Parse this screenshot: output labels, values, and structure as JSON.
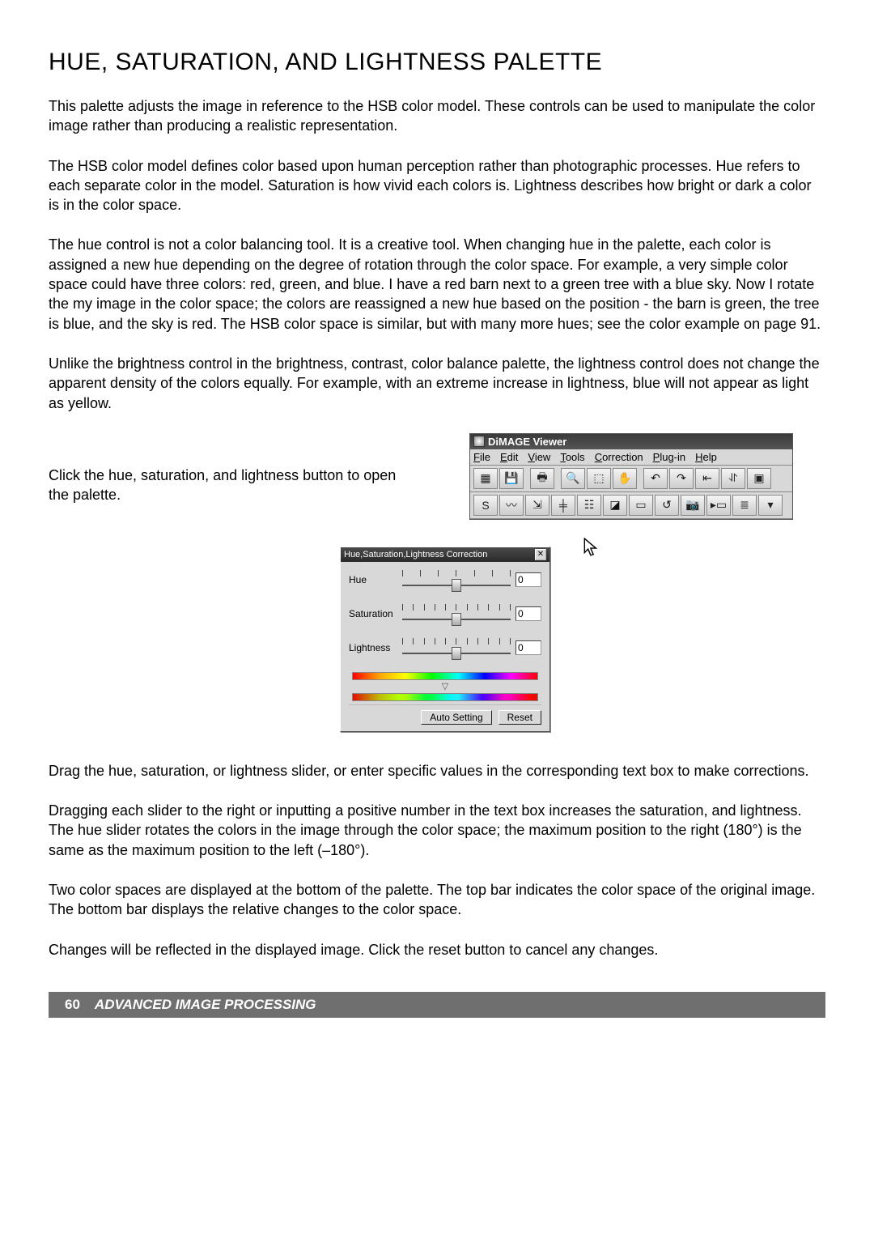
{
  "page": {
    "title": "HUE, SATURATION, AND LIGHTNESS PALETTE",
    "paragraphs": [
      "This palette adjusts the image in reference to the HSB color model. These controls can be used to manipulate the color image rather than producing a realistic representation.",
      "The HSB color model defines color based upon human perception rather than photographic processes. Hue refers to each separate color in the model. Saturation is how vivid each colors is. Lightness describes how bright or dark a color is in the color space.",
      "The hue control is not a color balancing tool. It is a creative tool. When changing hue in the palette, each color is assigned a new hue depending on the degree of rotation through the color space. For example, a very simple color space could have three colors: red, green, and blue. I have a red barn next to a green tree with a blue sky. Now I rotate the my image in the color space; the colors are reassigned a new hue based on the position - the barn is green, the tree is blue, and the sky is red. The HSB color space is similar, but with many more hues; see the color example on page 91.",
      "Unlike the brightness control in the brightness, contrast, color balance palette, the lightness control does not change the apparent density of the colors equally. For example, with an extreme increase in lightness, blue will not appear as light as yellow."
    ],
    "side_paragraph": "Click the hue, saturation, and lightness button to open the palette.",
    "lower_paragraphs": [
      "Drag the hue, saturation, or lightness slider, or enter specific values in the corresponding text box to make corrections.",
      "Dragging each slider to the right or inputting a positive number in the text box increases the saturation, and lightness. The hue slider rotates the colors in the image through the color space; the maximum position to the right (180°) is the same as the maximum position to the left (–180°).",
      "Two color spaces are displayed at the bottom of the palette. The top bar indicates the color space of the original image. The bottom bar displays the relative changes to the color space.",
      "Changes will be reflected in the displayed image. Click the reset button to cancel any changes."
    ]
  },
  "viewer": {
    "app_title": "DiMAGE Viewer",
    "menus": [
      "File",
      "Edit",
      "View",
      "Tools",
      "Correction",
      "Plug-in",
      "Help"
    ],
    "toolbar1_icons": [
      "thumbnails-icon",
      "save-icon",
      "print-icon",
      "zoom-icon",
      "marquee-icon",
      "hand-icon",
      "rotate-ccw-icon",
      "rotate-cw-icon",
      "flip-horizontal-icon",
      "flip-vertical-icon",
      "fit-icon"
    ],
    "toolbar1_glyphs": [
      "▦",
      "💾",
      "🖶",
      "🔍",
      "⬚",
      "✋",
      "↶",
      "↷",
      "⇤",
      "⥯",
      "▣"
    ],
    "toolbar2_icons": [
      "sharpen-icon",
      "curves-icon",
      "levels-icon",
      "color-balance-icon",
      "hsl-palette-icon",
      "variation-icon",
      "compare-icon",
      "undo-icon",
      "snapshot-icon",
      "preview-icon",
      "metadata-icon",
      "options-dropdown-icon"
    ],
    "toolbar2_glyphs": [
      "S",
      "〰",
      "⇲",
      "╪",
      "☷",
      "◪",
      "▭",
      "↺",
      "📷",
      "▸▭",
      "≣",
      "▾"
    ]
  },
  "hsl_palette": {
    "title": "Hue,Saturation,Lightness Correction",
    "rows": [
      {
        "label": "Hue",
        "value": "0"
      },
      {
        "label": "Saturation",
        "value": "0"
      },
      {
        "label": "Lightness",
        "value": "0"
      }
    ],
    "buttons": {
      "auto": "Auto Setting",
      "reset": "Reset"
    }
  },
  "footer": {
    "page_number": "60",
    "section": "ADVANCED IMAGE PROCESSING"
  }
}
